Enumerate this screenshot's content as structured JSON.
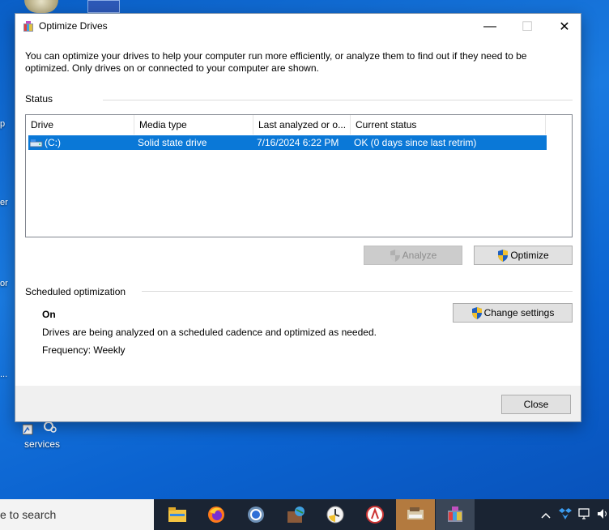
{
  "desktop": {
    "services_label": "services",
    "edge_texts": [
      "p",
      "er",
      "or",
      "..."
    ]
  },
  "window": {
    "title": "Optimize Drives",
    "minimize_glyph": "—",
    "maximize_glyph": "☐",
    "close_glyph": "✕",
    "intro": "You can optimize your drives to help your computer run more efficiently, or analyze them to find out if they need to be optimized. Only drives on or connected to your computer are shown.",
    "status_label": "Status",
    "columns": [
      "Drive",
      "Media type",
      "Last analyzed or o...",
      "Current status"
    ],
    "rows": [
      {
        "drive": "(C:)",
        "media_type": "Solid state drive",
        "last_analyzed": "7/16/2024 6:22 PM",
        "status": "OK (0 days since last retrim)",
        "selected": true
      }
    ],
    "analyze_label": "Analyze",
    "optimize_label": "Optimize",
    "scheduled_label": "Scheduled optimization",
    "schedule_state": "On",
    "schedule_description": "Drives are being analyzed on a scheduled cadence and optimized as needed.",
    "frequency": "Frequency: Weekly",
    "change_settings_label": "Change settings",
    "close_label": "Close"
  },
  "taskbar": {
    "search_text": "e to search",
    "apps": [
      "file-explorer",
      "firefox",
      "chrome",
      "app-4",
      "clock-app",
      "app-6",
      "app-7",
      "optimize-drives"
    ]
  },
  "colors": {
    "selection": "#0a78d7",
    "desktop": "#0b63d0",
    "taskbar": "#1a2433"
  }
}
